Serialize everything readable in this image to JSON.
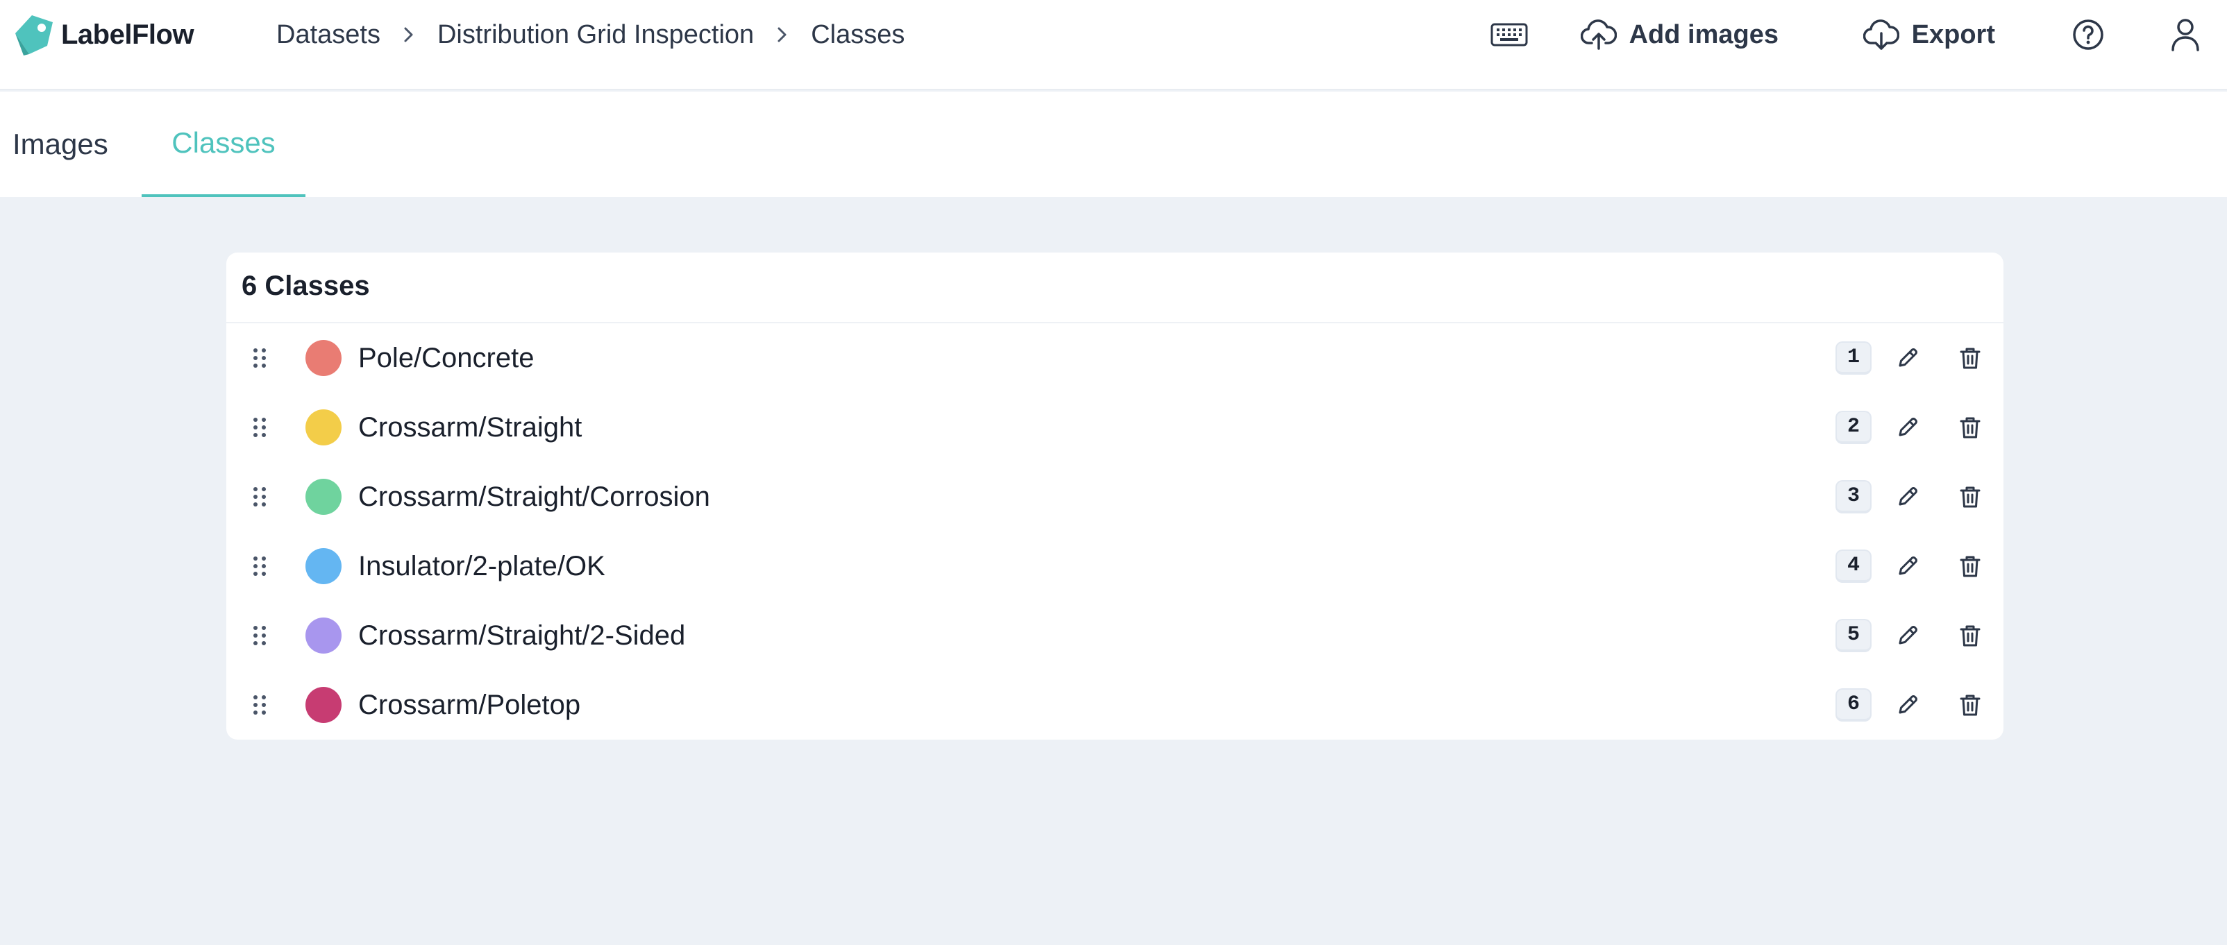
{
  "app": {
    "name": "LabelFlow",
    "brand_color": "#4fc3bd"
  },
  "breadcrumb": {
    "items": [
      "Datasets",
      "Distribution Grid Inspection",
      "Classes"
    ],
    "separator_icon": "chevron-right-icon"
  },
  "header_actions": {
    "keyboard_icon": "keyboard-icon",
    "add_images_label": "Add images",
    "add_images_icon": "cloud-upload-icon",
    "export_label": "Export",
    "export_icon": "cloud-download-icon",
    "help_icon": "help-circle-icon",
    "user_icon": "user-icon"
  },
  "tabs": [
    {
      "label": "Images",
      "active": false
    },
    {
      "label": "Classes",
      "active": true
    }
  ],
  "classes_panel": {
    "title": "6 Classes",
    "items": [
      {
        "name": "Pole/Concrete",
        "color": "#e97c73",
        "shortcut": "1"
      },
      {
        "name": "Crossarm/Straight",
        "color": "#f3cd49",
        "shortcut": "2"
      },
      {
        "name": "Crossarm/Straight/Corrosion",
        "color": "#6fd39e",
        "shortcut": "3"
      },
      {
        "name": "Insulator/2-plate/OK",
        "color": "#64b6f2",
        "shortcut": "4"
      },
      {
        "name": "Crossarm/Straight/2-Sided",
        "color": "#a896ee",
        "shortcut": "5"
      },
      {
        "name": "Crossarm/Poletop",
        "color": "#c73c72",
        "shortcut": "6"
      }
    ]
  },
  "colors": {
    "page_background": "#edf1f6",
    "panel_background": "#ffffff",
    "text_primary": "#1a202c",
    "icon_color": "#2d3748"
  }
}
